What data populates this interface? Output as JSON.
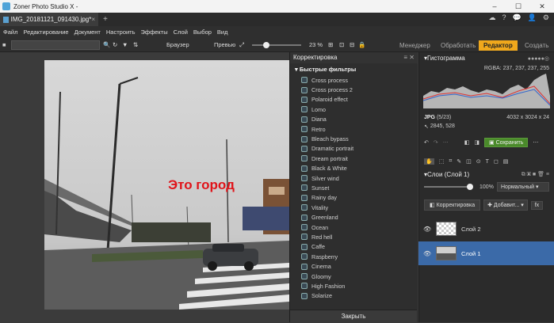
{
  "window": {
    "title": "Zoner Photo Studio X -",
    "controls": {
      "minimize": "–",
      "maximize": "☐",
      "close": "✕"
    }
  },
  "tabs": [
    {
      "label": "IMG_20181121_091430.jpg*",
      "close": "×"
    }
  ],
  "tab_plus": "+",
  "tab_right_icons": [
    "☁",
    "?",
    "💬",
    "👤",
    "⚙"
  ],
  "menu": [
    "Файл",
    "Редактирование",
    "Документ",
    "Настроить",
    "Эффекты",
    "Слой",
    "Выбор",
    "Вид"
  ],
  "toolbar": {
    "browser": "Браузер",
    "preview": "Превью",
    "zoom": "23 %"
  },
  "modes": [
    {
      "label": "Менеджер",
      "active": false
    },
    {
      "label": "Обработать",
      "active": false
    },
    {
      "label": "Редактор",
      "active": true
    },
    {
      "label": "Создать",
      "active": false
    }
  ],
  "canvas": {
    "overlay_text": "Это город"
  },
  "adjust_panel": {
    "title": "Корректировка",
    "section": "Быстрые фильтры",
    "filters": [
      "Cross process",
      "Cross process 2",
      "Polaroid effect",
      "Lomo",
      "Diana",
      "Retro",
      "Bleach bypass",
      "Dramatic portrait",
      "Dream portrait",
      "Black & White",
      "Silver wind",
      "Sunset",
      "Rainy day",
      "Vitality",
      "Greenland",
      "Ocean",
      "Red hell",
      "Caffe",
      "Raspberry",
      "Cinema",
      "Gloomy",
      "High Fashion",
      "Solarize"
    ],
    "close_label": "Закрыть"
  },
  "histogram": {
    "title": "Гистограмма",
    "rgba": "RGBA: 237, 237, 237, 255",
    "format": "JPG",
    "index": "(5/23)",
    "dimensions": "4032 x 3024 x 24",
    "cursor": "2845, 528"
  },
  "actions": {
    "save": "Сохранить"
  },
  "layers_panel": {
    "title": "Слои (Слой 1)",
    "opacity": "100%",
    "blend_mode": "Нормальный",
    "tab_adjust": "Корректировка",
    "add_label": "Добавит...",
    "fx": "fx",
    "layers": [
      {
        "name": "Слой 2",
        "selected": false
      },
      {
        "name": "Слой 1",
        "selected": true
      }
    ]
  },
  "colors": {
    "accent": "#f0a81c",
    "selection": "#3b6aa8",
    "save_green": "#4a8a2a",
    "overlay_text": "#e0141a"
  }
}
